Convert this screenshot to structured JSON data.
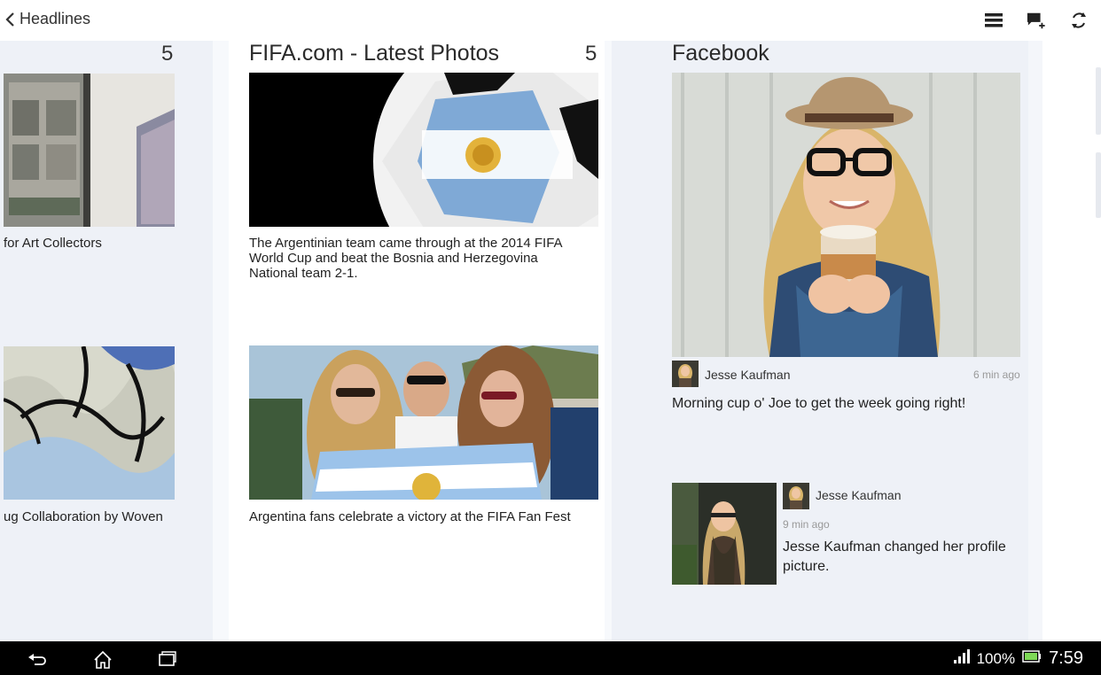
{
  "header": {
    "back_label": "Headlines"
  },
  "columns": {
    "left": {
      "count": "5",
      "items": [
        {
          "caption": "for Art Collectors"
        },
        {
          "caption": "ug Collaboration by Woven"
        }
      ]
    },
    "fifa": {
      "title": "FIFA.com - Latest Photos",
      "count": "5",
      "items": [
        {
          "caption": "The Argentinian team came through at the 2014 FIFA World Cup and beat the Bosnia and Herzegovina National team 2-1."
        },
        {
          "caption": "Argentina fans celebrate a victory at the FIFA Fan Fest"
        }
      ]
    },
    "facebook": {
      "title": "Facebook",
      "post1": {
        "author": "Jesse Kaufman",
        "time": "6 min ago",
        "text": "Morning cup o' Joe to get the week going right!"
      },
      "post2": {
        "author": "Jesse Kaufman",
        "time": "9 min ago",
        "text": "Jesse Kaufman changed her profile picture."
      }
    }
  },
  "status_bar": {
    "battery": "100%",
    "time": "7:59"
  },
  "icons": {
    "back": "chevron-left-icon",
    "menu": "menu-icon",
    "add_comment": "add-comment-icon",
    "refresh": "refresh-icon",
    "nav_back": "nav-back-icon",
    "nav_home": "nav-home-icon",
    "nav_recent": "nav-recent-apps-icon",
    "signal": "signal-icon",
    "battery": "battery-icon"
  }
}
